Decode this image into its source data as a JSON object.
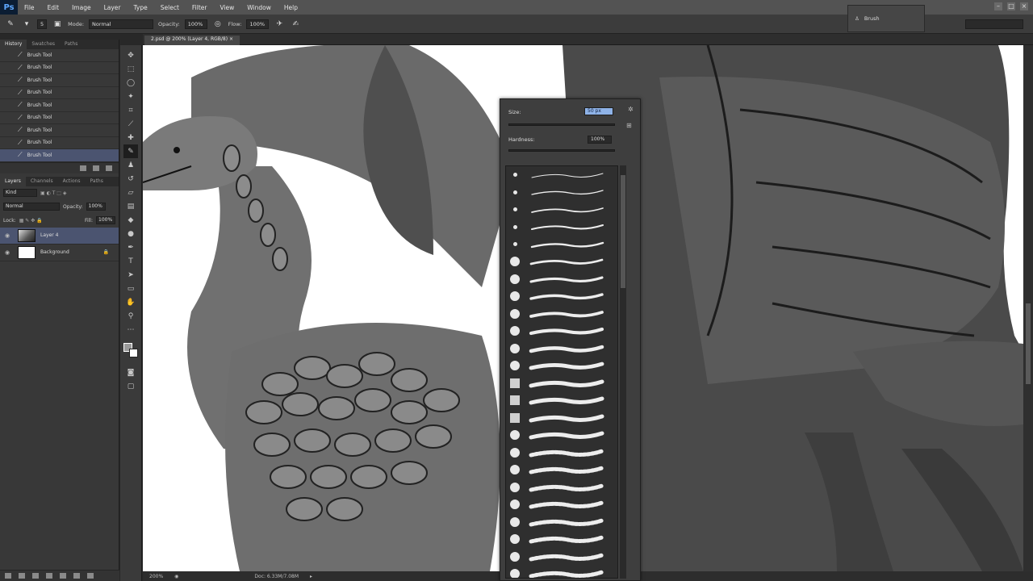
{
  "app": {
    "logo": "Ps"
  },
  "menu": [
    "File",
    "Edit",
    "Image",
    "Layer",
    "Type",
    "Select",
    "Filter",
    "View",
    "Window",
    "Help"
  ],
  "options_bar": {
    "brush_size": "5",
    "mode_label": "Mode:",
    "mode_value": "Normal",
    "opacity_label": "Opacity:",
    "opacity_value": "100%",
    "flow_label": "Flow:",
    "flow_value": "100%"
  },
  "brush_presets_panel": {
    "label": "Brush"
  },
  "history_panel": {
    "tabs": [
      "History",
      "Swatches",
      "Paths"
    ],
    "items": [
      "Brush Tool",
      "Brush Tool",
      "Brush Tool",
      "Brush Tool",
      "Brush Tool",
      "Brush Tool",
      "Brush Tool",
      "Brush Tool",
      "Brush Tool"
    ],
    "selected_index": 8
  },
  "layers_panel": {
    "tabs": [
      "Layers",
      "Channels",
      "Actions",
      "Paths"
    ],
    "kind_label": "Kind",
    "blend_mode": "Normal",
    "opacity_label": "Opacity:",
    "opacity_value": "100%",
    "lock_label": "Lock:",
    "fill_label": "Fill:",
    "fill_value": "100%",
    "layers": [
      {
        "name": "Layer 4",
        "selected": true
      },
      {
        "name": "Background",
        "selected": false
      }
    ]
  },
  "document": {
    "tab_title": "2.psd @ 200% (Layer 4, RGB/8)",
    "zoom": "200%",
    "doc_size": "Doc: 6.33M/7.08M"
  },
  "brush_picker": {
    "size_label": "Size:",
    "size_value": "50 px",
    "hardness_label": "Hardness:",
    "hardness_value": "100%",
    "brush_sizes": [
      "",
      "5",
      "9",
      "13",
      "19",
      "",
      "",
      "",
      "",
      "",
      "",
      "",
      "",
      "",
      "",
      "",
      "",
      "",
      "",
      "",
      "",
      "",
      "",
      "",
      "",
      "100"
    ]
  },
  "colors": {
    "selection": "#4b5470",
    "foreground": "#9a9a9a",
    "background": "#ffffff",
    "highlight_field": "#8fb3e8"
  }
}
